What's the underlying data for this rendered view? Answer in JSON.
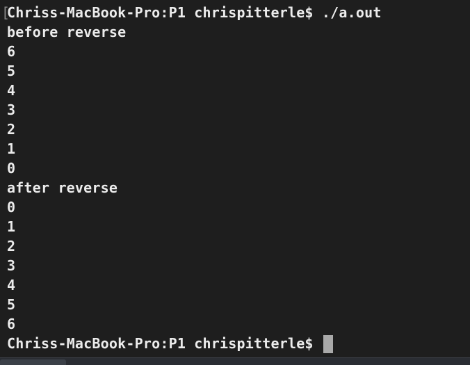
{
  "terminal": {
    "bracket": "[",
    "lines": [
      "Chriss-MacBook-Pro:P1 chrispitterle$ ./a.out",
      "before reverse",
      "6",
      "5",
      "4",
      "3",
      "2",
      "1",
      "0",
      "after reverse",
      "0",
      "1",
      "2",
      "3",
      "4",
      "5",
      "6"
    ],
    "prompt": "Chriss-MacBook-Pro:P1 chrispitterle$ "
  }
}
